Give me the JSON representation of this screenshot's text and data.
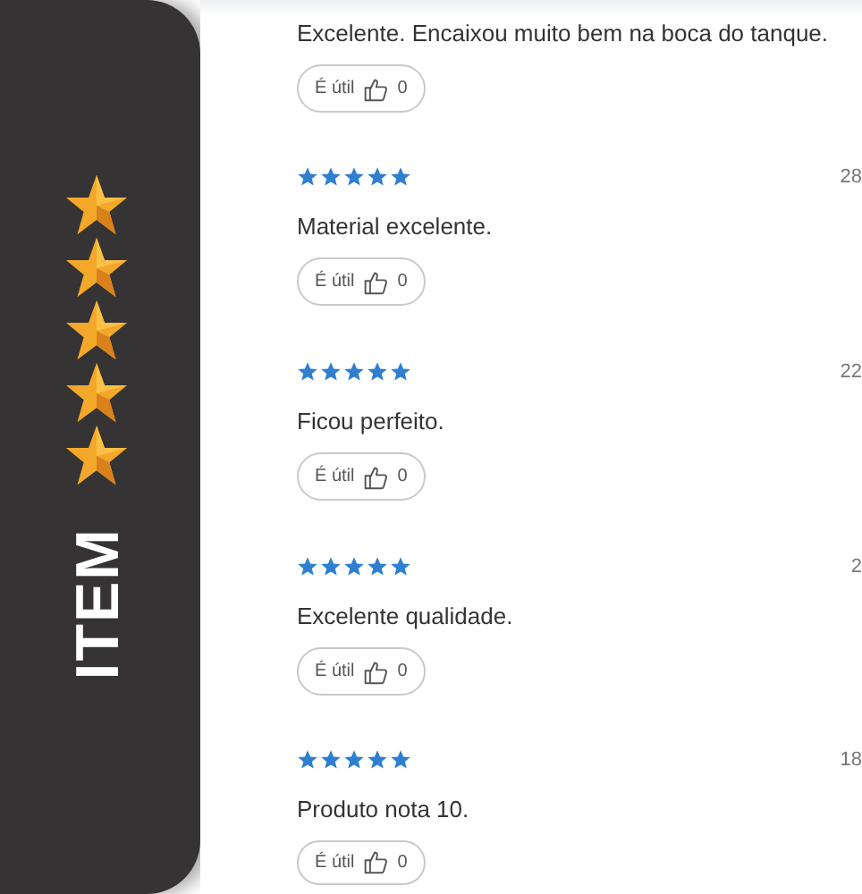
{
  "badge": {
    "label": "ITEM"
  },
  "reviews": [
    {
      "text": "Excelente. Encaixou muito bem na boca do tanque.",
      "helpful": {
        "label": "É útil",
        "count": "0"
      }
    },
    {
      "stars": 5,
      "date": "28",
      "text": "Material excelente.",
      "helpful": {
        "label": "É útil",
        "count": "0"
      }
    },
    {
      "stars": 5,
      "date": "22",
      "text": "Ficou perfeito.",
      "helpful": {
        "label": "É útil",
        "count": "0"
      }
    },
    {
      "stars": 5,
      "date": "2",
      "text": "Excelente qualidade.",
      "helpful": {
        "label": "É útil",
        "count": "0"
      }
    },
    {
      "stars": 5,
      "date": "18",
      "text": "Produto nota 10.",
      "helpful": {
        "label": "É útil",
        "count": "0"
      }
    }
  ]
}
